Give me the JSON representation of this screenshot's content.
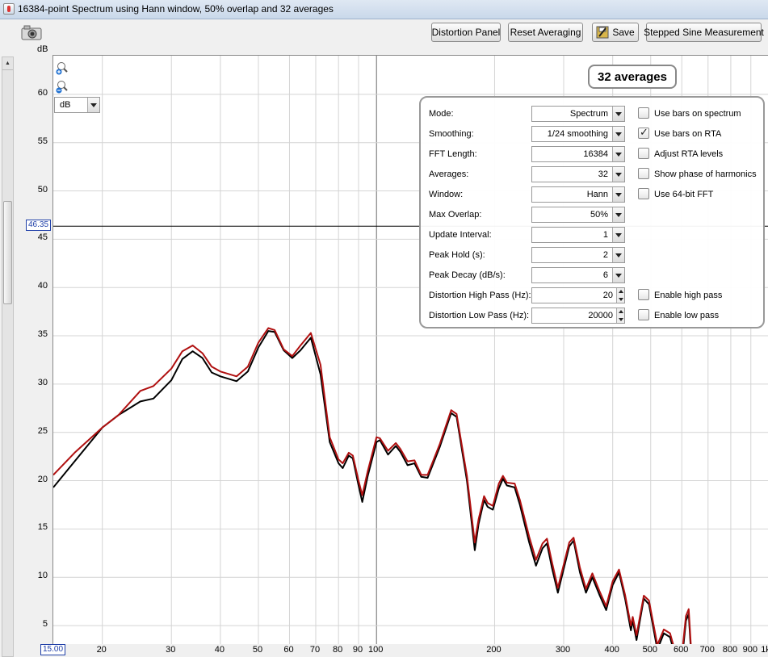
{
  "window": {
    "title": "16384-point Spectrum using Hann window, 50% overlap and 32 averages"
  },
  "toolbar": {
    "snapshot_icon": "camera-icon",
    "distortion_panel": "Distortion Panel",
    "reset_averaging": "Reset Averaging",
    "save": "Save",
    "save_icon": "save-icon",
    "stepped_sine": "Stepped Sine Measurement"
  },
  "plot": {
    "y_unit": "dB",
    "y_ticks": [
      "60",
      "55",
      "50",
      "45",
      "40",
      "35",
      "30",
      "25",
      "20",
      "15",
      "10",
      "5"
    ],
    "x_ticks": [
      "20",
      "30",
      "40",
      "50",
      "60",
      "70",
      "80",
      "90",
      "100",
      "200",
      "300",
      "400",
      "500",
      "600",
      "700",
      "800",
      "900",
      "1k"
    ],
    "x_start": "15.00",
    "cursor_value": "46.35",
    "unit_select": "dB",
    "averages_badge": "32 averages",
    "colors": {
      "averaged": "#000000",
      "peak": "#b01010",
      "grid": "#d4d4d4"
    }
  },
  "chart_data": {
    "type": "line",
    "x_scale": "log",
    "xlim": [
      15,
      1000
    ],
    "ylim": [
      3,
      64
    ],
    "cursor_y": 46.35,
    "series": [
      {
        "values": [
          [
            15,
            19.3
          ],
          [
            17,
            22
          ],
          [
            20,
            25.5
          ],
          [
            22,
            26.8
          ],
          [
            25,
            28.2
          ],
          [
            27,
            28.5
          ],
          [
            30,
            30.4
          ],
          [
            32,
            32.6
          ],
          [
            34,
            33.4
          ],
          [
            36,
            32.7
          ],
          [
            38,
            31.2
          ],
          [
            40,
            30.8
          ],
          [
            44,
            30.3
          ],
          [
            47,
            31.3
          ],
          [
            50,
            33.8
          ],
          [
            53,
            35.5
          ],
          [
            55,
            35.4
          ],
          [
            58,
            33.5
          ],
          [
            61,
            32.7
          ],
          [
            64,
            33.5
          ],
          [
            68,
            34.8
          ],
          [
            72,
            31
          ],
          [
            76,
            24
          ],
          [
            80,
            21.8
          ],
          [
            82,
            21.3
          ],
          [
            85,
            22.6
          ],
          [
            87,
            22.3
          ],
          [
            90,
            19.5
          ],
          [
            92,
            17.8
          ],
          [
            95,
            20.5
          ],
          [
            100,
            24
          ],
          [
            102,
            24.2
          ],
          [
            107,
            22.7
          ],
          [
            112,
            23.6
          ],
          [
            115,
            23
          ],
          [
            120,
            21.6
          ],
          [
            125,
            21.8
          ],
          [
            130,
            20.4
          ],
          [
            135,
            20.3
          ],
          [
            145,
            23.5
          ],
          [
            155,
            27
          ],
          [
            160,
            26.6
          ],
          [
            170,
            20
          ],
          [
            178,
            12.8
          ],
          [
            182,
            15.5
          ],
          [
            188,
            18
          ],
          [
            192,
            17.3
          ],
          [
            198,
            17
          ],
          [
            205,
            19.2
          ],
          [
            210,
            20.2
          ],
          [
            215,
            19.5
          ],
          [
            225,
            19.3
          ],
          [
            232,
            17.5
          ],
          [
            245,
            13.6
          ],
          [
            255,
            11.2
          ],
          [
            265,
            13
          ],
          [
            272,
            13.5
          ],
          [
            280,
            11
          ],
          [
            290,
            8.4
          ],
          [
            310,
            13.2
          ],
          [
            318,
            13.8
          ],
          [
            330,
            10.5
          ],
          [
            342,
            8.4
          ],
          [
            355,
            10
          ],
          [
            370,
            8.2
          ],
          [
            385,
            6.6
          ],
          [
            400,
            9.2
          ],
          [
            415,
            10.5
          ],
          [
            430,
            7.8
          ],
          [
            445,
            4.5
          ],
          [
            450,
            5.5
          ],
          [
            460,
            3.5
          ],
          [
            480,
            7.8
          ],
          [
            495,
            7.2
          ],
          [
            520,
            2.5
          ],
          [
            540,
            4.2
          ],
          [
            560,
            3.8
          ],
          [
            580,
            1.5
          ],
          [
            600,
            1.2
          ],
          [
            615,
            5.5
          ],
          [
            625,
            6.2
          ],
          [
            635,
            1.5
          ],
          [
            660,
            0
          ]
        ]
      },
      {
        "values": [
          [
            15,
            20.6
          ],
          [
            17,
            22.9
          ],
          [
            20,
            25.5
          ],
          [
            22,
            26.8
          ],
          [
            25,
            29.3
          ],
          [
            27,
            29.8
          ],
          [
            30,
            31.6
          ],
          [
            32,
            33.4
          ],
          [
            34,
            34
          ],
          [
            36,
            33.2
          ],
          [
            38,
            31.8
          ],
          [
            40,
            31.3
          ],
          [
            44,
            30.8
          ],
          [
            47,
            31.8
          ],
          [
            50,
            34.3
          ],
          [
            53,
            35.8
          ],
          [
            55,
            35.6
          ],
          [
            58,
            33.6
          ],
          [
            61,
            32.9
          ],
          [
            64,
            34
          ],
          [
            68,
            35.3
          ],
          [
            72,
            32
          ],
          [
            76,
            24.5
          ],
          [
            80,
            22.2
          ],
          [
            82,
            21.8
          ],
          [
            85,
            22.9
          ],
          [
            87,
            22.6
          ],
          [
            90,
            20
          ],
          [
            92,
            18.5
          ],
          [
            95,
            21
          ],
          [
            100,
            24.5
          ],
          [
            102,
            24.4
          ],
          [
            107,
            23.1
          ],
          [
            112,
            23.9
          ],
          [
            115,
            23.3
          ],
          [
            120,
            22
          ],
          [
            125,
            22.1
          ],
          [
            130,
            20.6
          ],
          [
            135,
            20.6
          ],
          [
            145,
            23.8
          ],
          [
            155,
            27.3
          ],
          [
            160,
            26.9
          ],
          [
            170,
            20.5
          ],
          [
            178,
            13.6
          ],
          [
            182,
            16
          ],
          [
            188,
            18.4
          ],
          [
            192,
            17.7
          ],
          [
            198,
            17.4
          ],
          [
            205,
            19.7
          ],
          [
            210,
            20.5
          ],
          [
            215,
            19.8
          ],
          [
            225,
            19.7
          ],
          [
            232,
            18
          ],
          [
            245,
            14.2
          ],
          [
            255,
            11.8
          ],
          [
            265,
            13.5
          ],
          [
            272,
            14
          ],
          [
            280,
            11.6
          ],
          [
            290,
            8.9
          ],
          [
            310,
            13.6
          ],
          [
            318,
            14.1
          ],
          [
            330,
            11
          ],
          [
            342,
            8.8
          ],
          [
            355,
            10.4
          ],
          [
            370,
            8.6
          ],
          [
            385,
            7
          ],
          [
            400,
            9.6
          ],
          [
            415,
            10.8
          ],
          [
            430,
            8.2
          ],
          [
            445,
            5
          ],
          [
            450,
            5.9
          ],
          [
            460,
            4
          ],
          [
            480,
            8.1
          ],
          [
            495,
            7.6
          ],
          [
            520,
            3
          ],
          [
            540,
            4.6
          ],
          [
            560,
            4.2
          ],
          [
            580,
            2
          ],
          [
            600,
            1.8
          ],
          [
            615,
            6
          ],
          [
            625,
            6.7
          ],
          [
            635,
            2
          ],
          [
            660,
            0
          ]
        ]
      }
    ]
  },
  "controls": {
    "rows": [
      {
        "label": "Mode:",
        "value": "Spectrum",
        "kind": "dropdown"
      },
      {
        "label": "Smoothing:",
        "value": "1/24 smoothing",
        "kind": "dropdown"
      },
      {
        "label": "FFT Length:",
        "value": "16384",
        "kind": "dropdown"
      },
      {
        "label": "Averages:",
        "value": "32",
        "kind": "dropdown"
      },
      {
        "label": "Window:",
        "value": "Hann",
        "kind": "dropdown"
      },
      {
        "label": "Max Overlap:",
        "value": "50%",
        "kind": "dropdown"
      },
      {
        "label": "Update Interval:",
        "value": "1",
        "kind": "dropdown"
      },
      {
        "label": "Peak Hold (s):",
        "value": "2",
        "kind": "dropdown"
      },
      {
        "label": "Peak Decay (dB/s):",
        "value": "6",
        "kind": "dropdown"
      },
      {
        "label": "Distortion High Pass (Hz):",
        "value": "20",
        "kind": "spinner"
      },
      {
        "label": "Distortion Low Pass (Hz):",
        "value": "20000",
        "kind": "spinner"
      }
    ],
    "checkboxes": [
      {
        "label": "Use bars on spectrum",
        "checked": false
      },
      {
        "label": "Use bars on RTA",
        "checked": true
      },
      {
        "label": "Adjust RTA levels",
        "checked": false
      },
      {
        "label": "Show phase of harmonics",
        "checked": false
      },
      {
        "label": "Use 64-bit FFT",
        "checked": false
      },
      {
        "label": "Enable high pass",
        "checked": false
      },
      {
        "label": "Enable low pass",
        "checked": false
      }
    ]
  }
}
